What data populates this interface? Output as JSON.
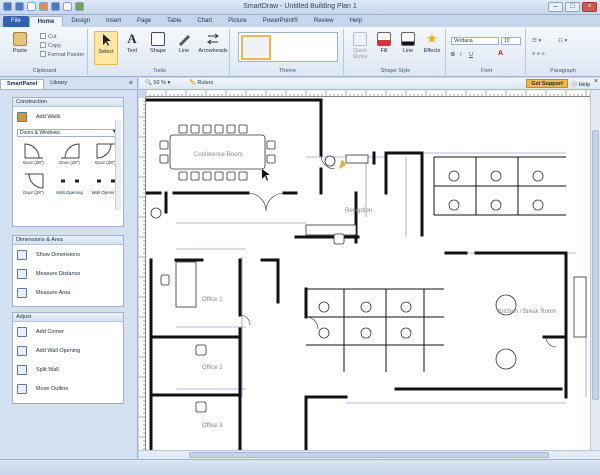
{
  "window": {
    "title": "SmartDraw - Untitled Building Plan 1",
    "minimize": "–",
    "maximize": "□",
    "close": "×"
  },
  "tabs": [
    {
      "label": "File"
    },
    {
      "label": "Home"
    },
    {
      "label": "Design"
    },
    {
      "label": "Insert"
    },
    {
      "label": "Page"
    },
    {
      "label": "Table"
    },
    {
      "label": "Chart"
    },
    {
      "label": "Picture"
    },
    {
      "label": "PowerPoint®"
    },
    {
      "label": "Review"
    },
    {
      "label": "Help"
    }
  ],
  "ribbon": {
    "clipboard": {
      "label": "Clipboard",
      "paste": "Paste",
      "cut": "Cut",
      "copy": "Copy",
      "format_painter": "Format Painter"
    },
    "tools": {
      "label": "Tools",
      "select": "Select",
      "text": "Text",
      "shape": "Shape",
      "line": "Line",
      "arrowheads": "Arrowheads"
    },
    "theme": {
      "label": "Theme"
    },
    "shape_style": {
      "label": "Shape Style",
      "quick_styles": "Quick Styles",
      "fill": "Fill",
      "line": "Line",
      "effects": "Effects"
    },
    "font": {
      "label": "Font",
      "family": "Verdana",
      "size": "10",
      "bold": "B",
      "italic": "I",
      "underline": "U"
    },
    "paragraph": {
      "label": "Paragraph"
    }
  },
  "left_panel": {
    "tabs": [
      {
        "label": "SmartPanel"
      },
      {
        "label": "Library"
      }
    ],
    "close": "×",
    "construction": {
      "title": "Construction",
      "add_walls": "Add Walls",
      "dropdown": "Doors & Windows",
      "shapes": [
        {
          "label": "Door (28\")"
        },
        {
          "label": "Door (28\")"
        },
        {
          "label": "Door (28\")"
        },
        {
          "label": "Door (28\")"
        },
        {
          "label": "Wall Opening"
        },
        {
          "label": "Wall Openin..."
        }
      ]
    },
    "dimensions": {
      "title": "Dimensions & Area",
      "items": [
        {
          "label": "Show Dimensions"
        },
        {
          "label": "Measure Distance"
        },
        {
          "label": "Measure Area"
        }
      ]
    },
    "adjust": {
      "title": "Adjust",
      "items": [
        {
          "label": "Add Corner"
        },
        {
          "label": "Add Wall Opening"
        },
        {
          "label": "Split Wall"
        },
        {
          "label": "Move Outline"
        }
      ]
    }
  },
  "canvas_bar": {
    "zoom": "50 %",
    "rulers": "Rulers",
    "support": "Get Support",
    "help": "Help",
    "close": "×"
  },
  "floorplan": {
    "rooms": {
      "conference": "Conference Room",
      "reception": "Reception",
      "office1": "Office 1",
      "office2": "Office 2",
      "office3": "Office 3",
      "kitchen": "Kitchen / Break Room"
    }
  },
  "colors": {
    "accent": "#2f62b0",
    "ribbon": "#dde7f4",
    "support": "#f5b942",
    "wall": "#111111",
    "dimension": "#7a6fc8"
  }
}
